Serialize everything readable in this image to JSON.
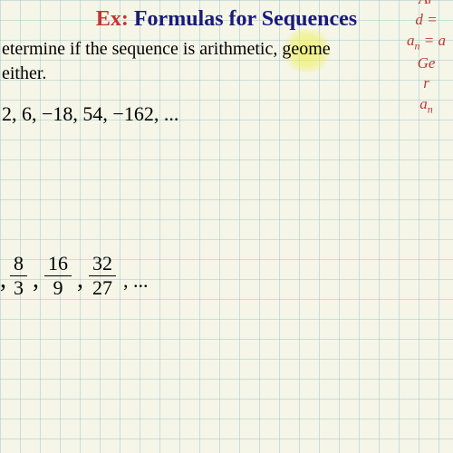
{
  "title": {
    "ex": "Ex:",
    "main": "Formulas for Sequences"
  },
  "prompt": {
    "line1": "etermine if the sequence is arithmetic, geome",
    "line2": "either."
  },
  "sequence1": "2, 6, −18, 54, −162, ...",
  "fractions": [
    {
      "num": "8",
      "den": "3"
    },
    {
      "num": "16",
      "den": "9"
    },
    {
      "num": "32",
      "den": "27"
    }
  ],
  "fractions_trail": ", ...",
  "formulas": {
    "l1": "Ar",
    "l2": "d = ",
    "l3_a": "a",
    "l3_n": "n",
    "l3_b": " = a",
    "l4": "Ge",
    "l5": "r",
    "l6_a": "a",
    "l6_n": "n"
  }
}
